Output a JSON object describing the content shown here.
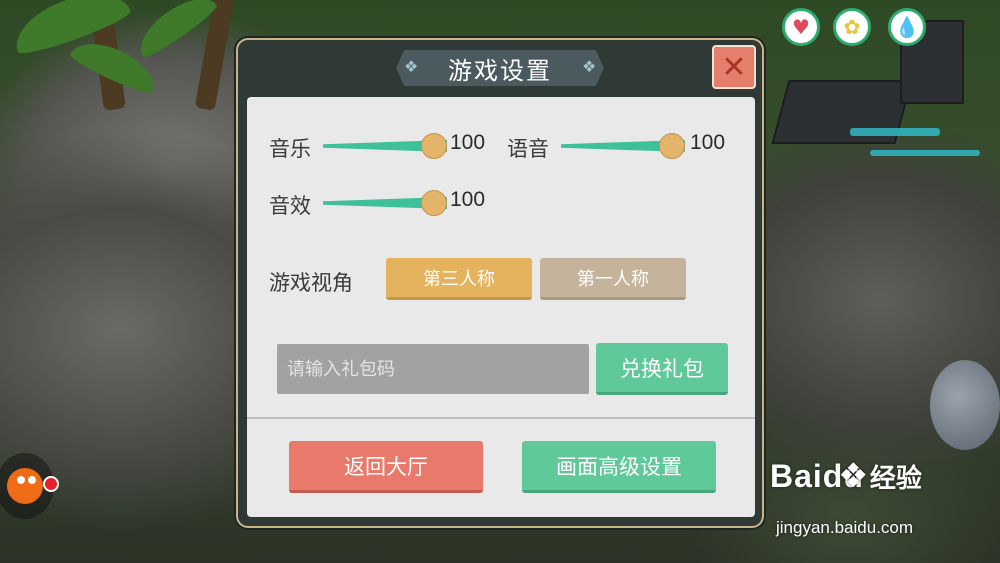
{
  "dialog": {
    "title": "游戏设置",
    "close_icon": "close-x-icon"
  },
  "audio": {
    "music": {
      "label": "音乐",
      "value": 100
    },
    "voice": {
      "label": "语音",
      "value": 100
    },
    "sfx": {
      "label": "音效",
      "value": 100
    }
  },
  "camera": {
    "label": "游戏视角",
    "options": [
      {
        "label": "第三人称",
        "selected": true
      },
      {
        "label": "第一人称",
        "selected": false
      }
    ]
  },
  "gift": {
    "input_value": "",
    "input_placeholder": "请输入礼包码",
    "redeem_label": "兑换礼包"
  },
  "actions": {
    "lobby_label": "返回大厅",
    "graphics_label": "画面高级设置"
  },
  "hud": {
    "status_icons": [
      "heart-icon",
      "energy-icon",
      "water-drop-icon"
    ]
  },
  "watermark": {
    "brand": "Bai",
    "brand_suffix": "du",
    "cn": "经验",
    "url": "jingyan.baidu.com"
  },
  "colors": {
    "accent_green": "#60c99a",
    "accent_red": "#e9796a",
    "accent_gold": "#e5b25e",
    "slider_fill": "#3fc09a"
  }
}
